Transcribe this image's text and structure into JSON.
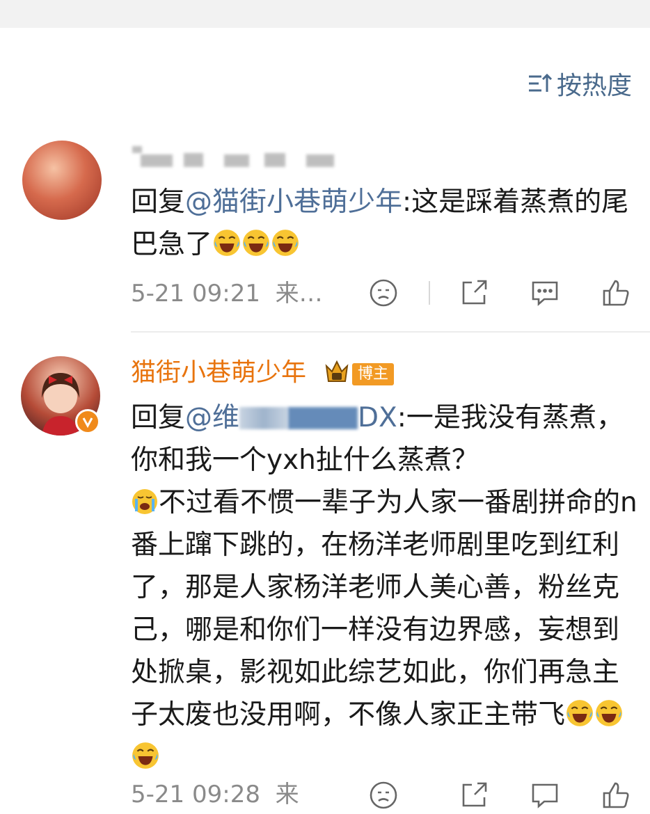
{
  "sort": {
    "label": "按热度"
  },
  "comments": [
    {
      "reply_prefix": "回复",
      "mention": "@猫街小巷萌少年",
      "text": ":这是踩着蒸煮的尾巴急了",
      "time": "5-21 09:21",
      "source": "来…"
    },
    {
      "username": "猫街小巷萌少年",
      "badge": "博主",
      "reply_prefix": "回复",
      "mention": "@维",
      "mention_end": "DX",
      "text": ":一是我没有蒸煮，你和我一个yxh扯什么蒸煮？",
      "text2": "不过看不惯一辈子为人家一番剧拼命的n番上蹿下跳的，在杨洋老师剧里吃到红利了，那是人家杨洋老师人美心善，粉丝克己，哪是和你们一样没有边界感，妄想到处掀桌，影视如此综艺如此，你们再急主子太废也没用啊，不像人家正主带飞",
      "time": "5-21 09:28",
      "source": "来"
    }
  ],
  "colors": {
    "mention": "#4f6f98",
    "blogger_name": "#e8740e",
    "badge_bg": "#f29a24",
    "meta": "#8a8a8a"
  },
  "icons": [
    "sort-icon",
    "dislike-icon",
    "share-icon",
    "comment-icon",
    "like-icon",
    "laugh-cry-emoji",
    "crying-emoji",
    "crown-icon",
    "verified-icon"
  ]
}
